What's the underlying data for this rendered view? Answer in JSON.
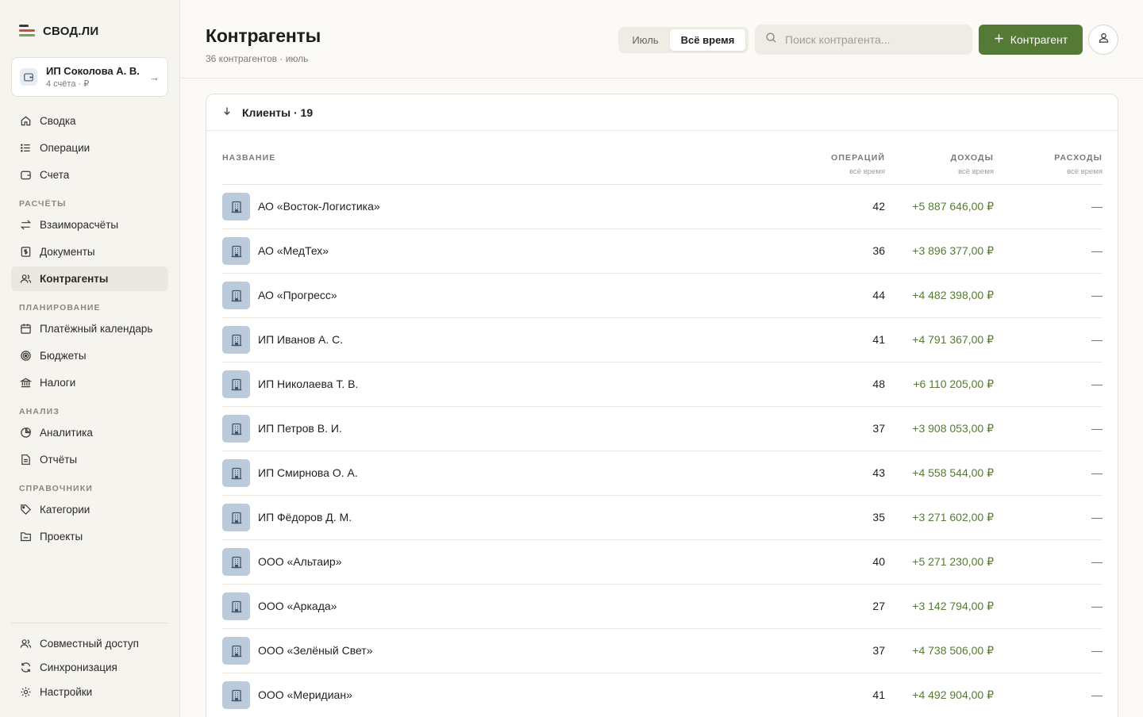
{
  "brand": {
    "name": "СВОД.ЛИ"
  },
  "account": {
    "name": "ИП Соколова А. В.",
    "sub": "4 счёта · ₽"
  },
  "nav": {
    "main": [
      {
        "label": "Сводка",
        "icon": "home-icon"
      },
      {
        "label": "Операции",
        "icon": "list-icon"
      },
      {
        "label": "Счета",
        "icon": "wallet-icon"
      }
    ],
    "sections": [
      {
        "title": "РАСЧЁТЫ",
        "items": [
          {
            "label": "Взаиморасчёты",
            "icon": "swap-icon"
          },
          {
            "label": "Документы",
            "icon": "document-dollar-icon"
          },
          {
            "label": "Контрагенты",
            "icon": "users-icon",
            "active": true
          }
        ]
      },
      {
        "title": "ПЛАНИРОВАНИЕ",
        "items": [
          {
            "label": "Платёжный календарь",
            "icon": "calendar-icon"
          },
          {
            "label": "Бюджеты",
            "icon": "target-icon"
          },
          {
            "label": "Налоги",
            "icon": "bank-icon"
          }
        ]
      },
      {
        "title": "АНАЛИЗ",
        "items": [
          {
            "label": "Аналитика",
            "icon": "pie-chart-icon"
          },
          {
            "label": "Отчёты",
            "icon": "report-icon"
          }
        ]
      },
      {
        "title": "СПРАВОЧНИКИ",
        "items": [
          {
            "label": "Категории",
            "icon": "tag-icon"
          },
          {
            "label": "Проекты",
            "icon": "folder-icon"
          }
        ]
      }
    ],
    "bottom": [
      {
        "label": "Совместный доступ",
        "icon": "users-icon"
      },
      {
        "label": "Синхронизация",
        "icon": "refresh-icon"
      },
      {
        "label": "Настройки",
        "icon": "gear-icon"
      }
    ]
  },
  "header": {
    "title": "Контрагенты",
    "subtitle": "36 контрагентов · июль",
    "period": {
      "options": [
        "Июль",
        "Всё время"
      ],
      "selected": "Всё время"
    },
    "search_placeholder": "Поиск контрагента...",
    "add_label": "Контрагент"
  },
  "group": {
    "title": "Клиенты · 19",
    "columns": {
      "name": "НАЗВАНИЕ",
      "ops": "ОПЕРАЦИЙ",
      "ops_sub": "всё время",
      "income": "ДОХОДЫ",
      "income_sub": "всё время",
      "expense": "РАСХОДЫ",
      "expense_sub": "всё время"
    },
    "rows": [
      {
        "name": "АО «Восток-Логистика»",
        "ops": "42",
        "income": "+5 887 646,00 ₽",
        "expense": "—"
      },
      {
        "name": "АО «МедТех»",
        "ops": "36",
        "income": "+3 896 377,00 ₽",
        "expense": "—"
      },
      {
        "name": "АО «Прогресс»",
        "ops": "44",
        "income": "+4 482 398,00 ₽",
        "expense": "—"
      },
      {
        "name": "ИП Иванов А. С.",
        "ops": "41",
        "income": "+4 791 367,00 ₽",
        "expense": "—"
      },
      {
        "name": "ИП Николаева Т. В.",
        "ops": "48",
        "income": "+6 110 205,00 ₽",
        "expense": "—"
      },
      {
        "name": "ИП Петров В. И.",
        "ops": "37",
        "income": "+3 908 053,00 ₽",
        "expense": "—"
      },
      {
        "name": "ИП Смирнова О. А.",
        "ops": "43",
        "income": "+4 558 544,00 ₽",
        "expense": "—"
      },
      {
        "name": "ИП Фёдоров Д. М.",
        "ops": "35",
        "income": "+3 271 602,00 ₽",
        "expense": "—"
      },
      {
        "name": "ООО «Альтаир»",
        "ops": "40",
        "income": "+5 271 230,00 ₽",
        "expense": "—"
      },
      {
        "name": "ООО «Аркада»",
        "ops": "27",
        "income": "+3 142 794,00 ₽",
        "expense": "—"
      },
      {
        "name": "ООО «Зелёный Свет»",
        "ops": "37",
        "income": "+4 738 506,00 ₽",
        "expense": "—"
      },
      {
        "name": "ООО «Меридиан»",
        "ops": "41",
        "income": "+4 492 904,00 ₽",
        "expense": "—"
      }
    ]
  },
  "colors": {
    "accent": "#557a35",
    "income": "#557a35",
    "row_icon_bg": "#bccbdb"
  }
}
